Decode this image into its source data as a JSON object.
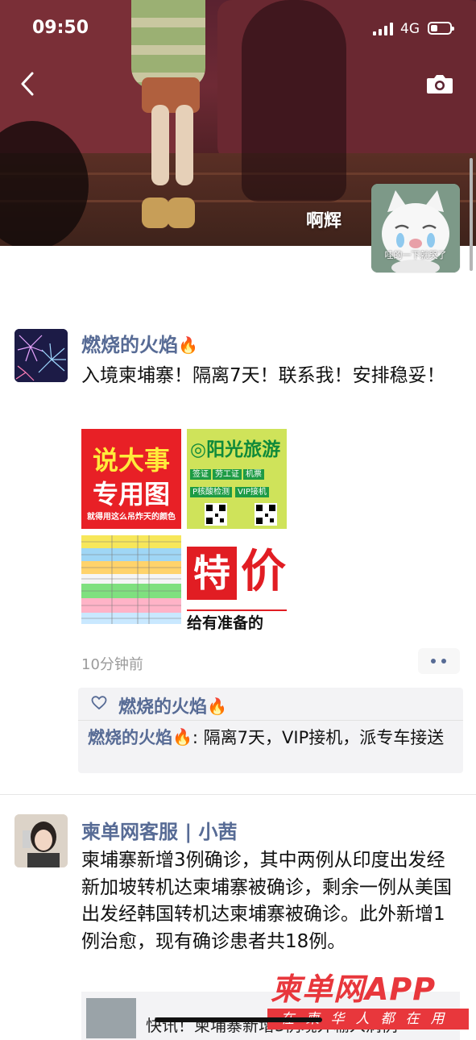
{
  "status_bar": {
    "time": "09:50",
    "network": "4G",
    "battery_level": 0.35
  },
  "cover": {
    "owner_name": "啊辉",
    "avatar_caption": "哇的一下就哭了"
  },
  "posts": [
    {
      "author": "燃烧的火焰",
      "text": "入境柬埔寨！隔离7天！联系我！安排稳妥！",
      "photos": [
        {
          "line1": "说大事",
          "line2": "专用图",
          "line3": "就得用这么吊炸天的颜色"
        },
        {
          "title": "◎阳光旅游",
          "tags": [
            "签证",
            "劳工证",
            "机票",
            "P核酸检测",
            "VIP接机"
          ]
        },
        {
          "caption": "flight schedule table"
        },
        {
          "big": "特价",
          "sub": "给有准备的"
        }
      ],
      "time": "10分钟前",
      "likes": "燃烧的火焰",
      "comments": [
        {
          "author": "燃烧的火焰",
          "text": ": 隔离7天，VIP接机，派专车接送"
        }
      ]
    },
    {
      "author": "柬单网客服 | 小茜",
      "text": "柬埔寨新增3例确诊，其中两例从印度出发经新加坡转机达柬埔寨被确诊，剩余一例从美国出发经韩国转机达柬埔寨被确诊。此外新增1例治愈，现有确诊患者共18例。",
      "link_title": "快讯！柬埔寨新增3例境外输入病例"
    }
  ],
  "watermark": {
    "main": "柬单网APP",
    "sub": "在柬华人都在用"
  },
  "colors": {
    "link_blue": "#576b95",
    "watermark_red": "#e8373c"
  }
}
